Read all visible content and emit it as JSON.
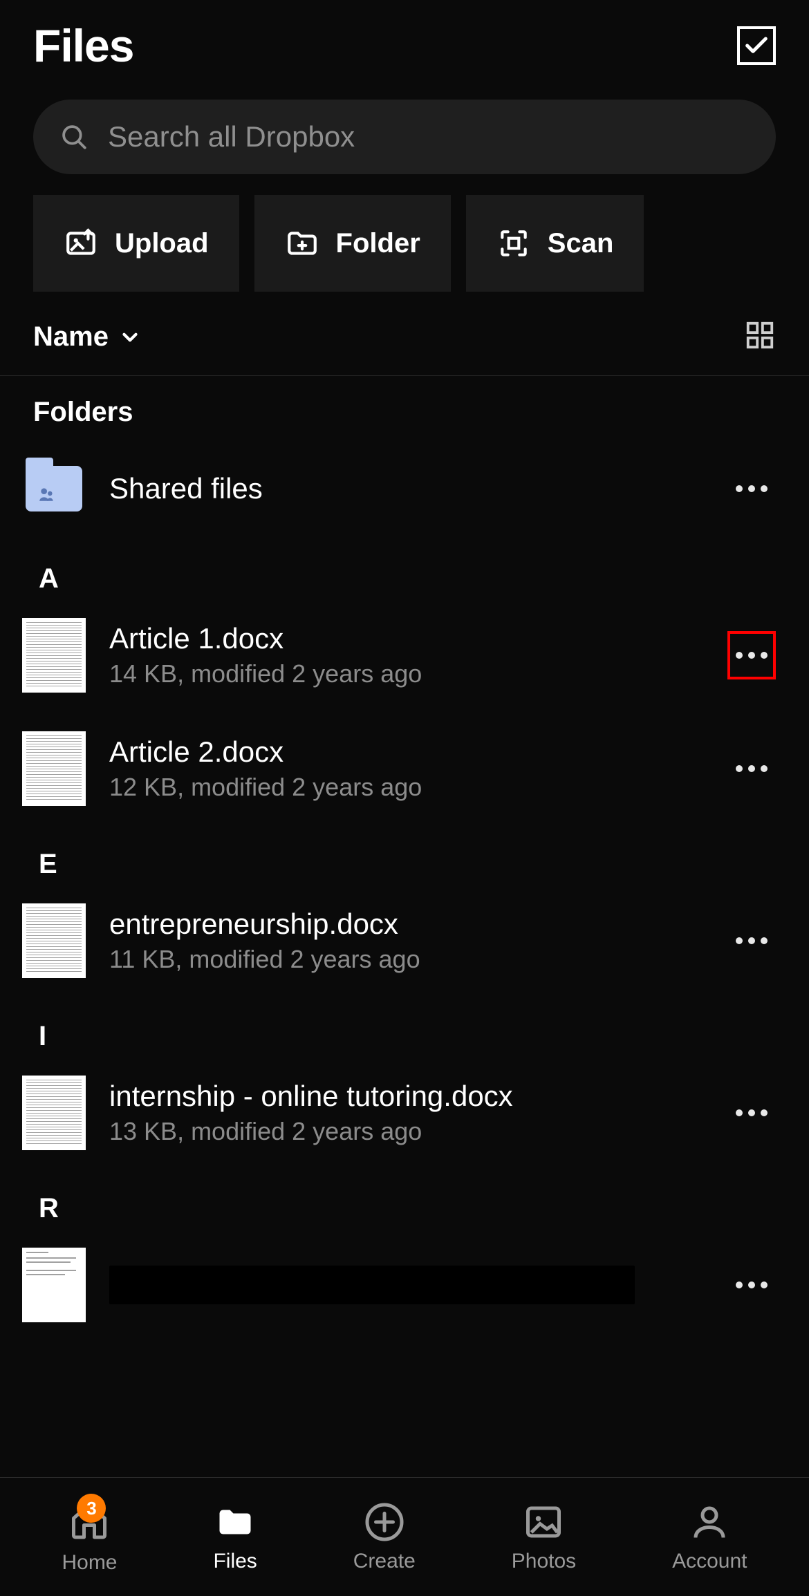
{
  "header": {
    "title": "Files"
  },
  "search": {
    "placeholder": "Search all Dropbox"
  },
  "actions": {
    "upload": "Upload",
    "folder": "Folder",
    "scan": "Scan"
  },
  "sort": {
    "label": "Name"
  },
  "sections": {
    "folders_label": "Folders",
    "folders": [
      {
        "name": "Shared files"
      }
    ],
    "groups": [
      {
        "letter": "A",
        "files": [
          {
            "name": "Article 1.docx",
            "meta": "14 KB, modified 2 years ago",
            "highlight": true
          },
          {
            "name": "Article 2.docx",
            "meta": "12 KB, modified 2 years ago"
          }
        ]
      },
      {
        "letter": "E",
        "files": [
          {
            "name": "entrepreneurship.docx",
            "meta": "11 KB, modified 2 years ago"
          }
        ]
      },
      {
        "letter": "I",
        "files": [
          {
            "name": "internship - online tutoring.docx",
            "meta": "13 KB, modified 2 years ago"
          }
        ]
      },
      {
        "letter": "R",
        "files": [
          {
            "name": "",
            "meta": "",
            "redacted": true,
            "sparse_thumb": true
          }
        ]
      }
    ]
  },
  "tabs": {
    "home": {
      "label": "Home",
      "badge": "3"
    },
    "files": {
      "label": "Files"
    },
    "create": {
      "label": "Create"
    },
    "photos": {
      "label": "Photos"
    },
    "account": {
      "label": "Account"
    }
  }
}
